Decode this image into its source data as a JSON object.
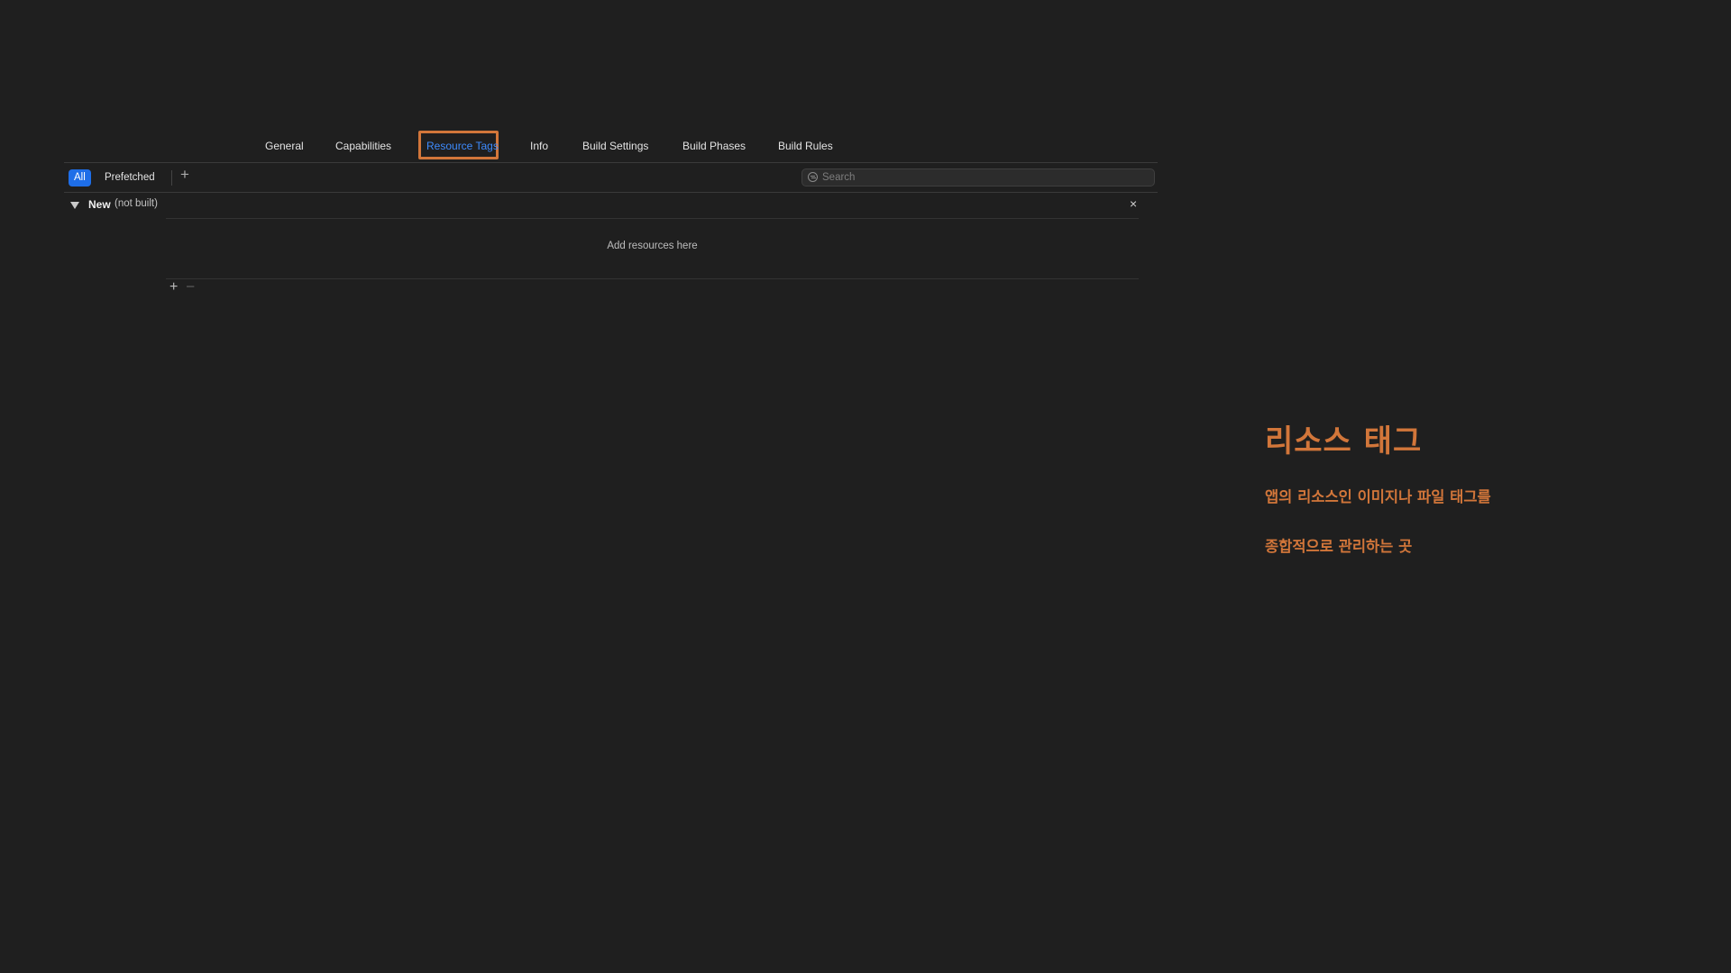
{
  "tabs": [
    {
      "label": "General",
      "active": false
    },
    {
      "label": "Capabilities",
      "active": false
    },
    {
      "label": "Resource Tags",
      "active": true
    },
    {
      "label": "Info",
      "active": false
    },
    {
      "label": "Build Settings",
      "active": false
    },
    {
      "label": "Build Phases",
      "active": false
    },
    {
      "label": "Build Rules",
      "active": false
    }
  ],
  "filter": {
    "all_label": "All",
    "prefetched_label": "Prefetched",
    "search_placeholder": "Search"
  },
  "tag_group": {
    "name": "New",
    "status": "(not built)",
    "empty_message": "Add resources here"
  },
  "annotation": {
    "title": "리소스 태그",
    "line1": "앱의 리소스인 이미지나 파일 태그를",
    "line2": "종합적으로 관리하는 곳"
  },
  "colors": {
    "background": "#1f1f1f",
    "accent_blue": "#1e6ee8",
    "active_tab_text": "#3d8bfd",
    "annotation_orange": "#d2763a"
  }
}
